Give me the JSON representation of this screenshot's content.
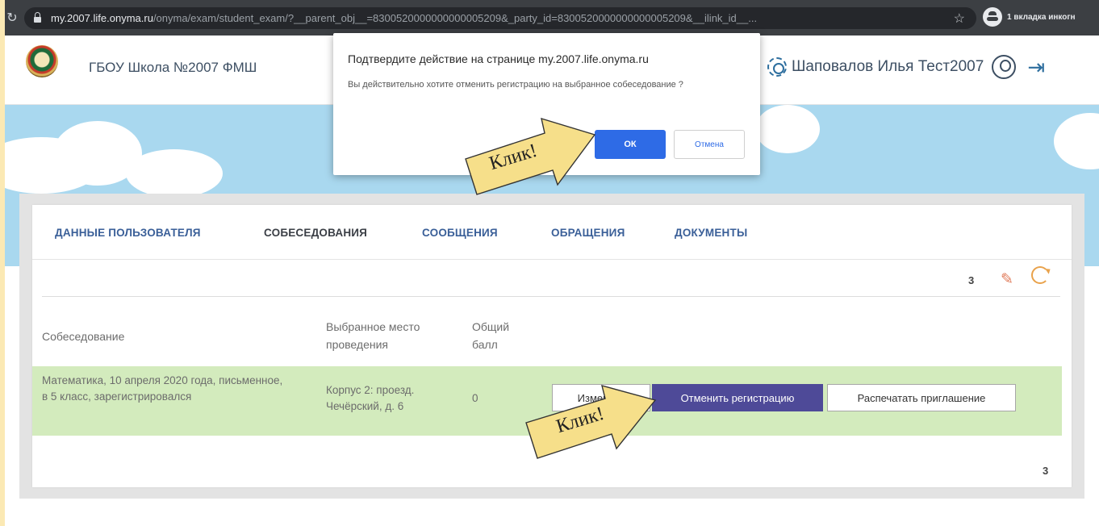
{
  "browser": {
    "url_host": "my.2007.life.onyma.ru",
    "url_path": "/onyma/exam/student_exam/?__parent_obj__=8300520000000000005209&_party_id=8300520000000000005209&__ilink_id__...",
    "incognito_label": "1 вкладка инкогн",
    "icons": {
      "reload": "reload-icon",
      "lock": "lock-icon",
      "star": "star-icon",
      "incognito": "incognito-icon"
    }
  },
  "header": {
    "school_name": "ГБОУ Школа №2007 ФМШ",
    "user_name": "Шаповалов Илья Тест2007",
    "icons": {
      "settings": "gear-icon",
      "profile": "avatar-icon",
      "logout": "logout-icon"
    }
  },
  "dialog": {
    "title": "Подтвердите действие на странице my.2007.life.onyma.ru",
    "message": "Вы действительно хотите отменить регистрацию на выбранное собеседование ?",
    "ok_label": "ОК",
    "cancel_label": "Отмена"
  },
  "tabs": [
    {
      "label": "ДАННЫЕ ПОЛЬЗОВАТЕЛЯ",
      "active": false
    },
    {
      "label": "СОБЕСЕДОВАНИЯ",
      "active": true
    },
    {
      "label": "СООБЩЕНИЯ",
      "active": false
    },
    {
      "label": "ОБРАЩЕНИЯ",
      "active": false
    },
    {
      "label": "ДОКУМЕНТЫ",
      "active": false
    }
  ],
  "toolbar": {
    "count": "3",
    "pin_icon": "pin-icon",
    "refresh_icon": "refresh-icon"
  },
  "table": {
    "columns": [
      "Собеседование",
      "Выбранное место проведения",
      "Общий балл"
    ],
    "rows": [
      {
        "interview": "Математика, 10 апреля 2020 года, письменное, в 5 класс, зарегистрировался",
        "place": "Корпус 2: проезд. Чечёрский, д. 6",
        "score": "0",
        "actions": {
          "change": "Изменить",
          "cancel": "Отменить регистрацию",
          "print": "Распечатать приглашение"
        }
      }
    ]
  },
  "footer_count": "3",
  "callouts": [
    {
      "text": "Клик!",
      "color": "#f6df8a"
    },
    {
      "text": "Клик!",
      "color": "#f6df8a"
    }
  ],
  "colors": {
    "tab_link": "#3a5f98",
    "primary_button": "#4e4a98",
    "row_highlight": "#d3ebbd",
    "dialog_ok": "#2e6be6",
    "sky": "#a9d8ef"
  }
}
